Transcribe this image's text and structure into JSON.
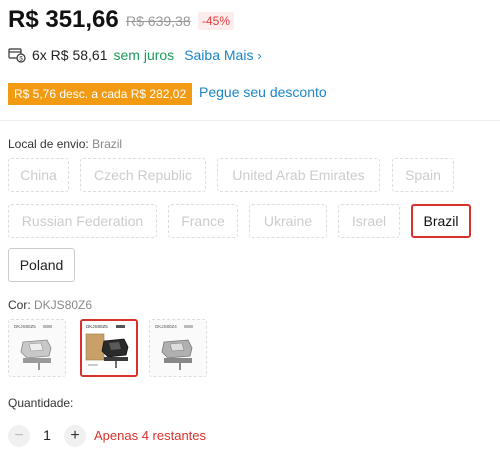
{
  "price": {
    "current": "R$ 351,66",
    "original": "R$ 639,38",
    "discount": "-45%"
  },
  "installments": {
    "icon": "installment-card-icon",
    "text": "6x R$ 58,61",
    "interest": "sem juros",
    "more_link": "Saiba Mais"
  },
  "promo": {
    "tag": "R$ 5,76 desc. a cada R$ 282,02",
    "link": "Pegue seu desconto",
    "tag_color": "#f39a13"
  },
  "shipping": {
    "label": "Local de envio:",
    "selected_value": "Brazil",
    "options": [
      {
        "label": "China",
        "state": "disabled"
      },
      {
        "label": "Czech Republic",
        "state": "disabled"
      },
      {
        "label": "United Arab Emirates",
        "state": "disabled"
      },
      {
        "label": "Spain",
        "state": "disabled"
      },
      {
        "label": "Russian Federation",
        "state": "disabled"
      },
      {
        "label": "France",
        "state": "disabled"
      },
      {
        "label": "Ukraine",
        "state": "disabled"
      },
      {
        "label": "Israel",
        "state": "disabled"
      },
      {
        "label": "Brazil",
        "state": "selected"
      },
      {
        "label": "Poland",
        "state": "available"
      }
    ]
  },
  "color": {
    "label": "Cor:",
    "selected_value": "DKJS80Z6",
    "thumbnails": [
      {
        "caption": "DKJS80Z5",
        "state": "disabled"
      },
      {
        "caption": "DKJS80Z6",
        "state": "selected"
      },
      {
        "caption": "DKJS80Z4",
        "state": "disabled"
      }
    ]
  },
  "quantity": {
    "label": "Quantidade:",
    "value": "1",
    "minus": "−",
    "plus": "+",
    "stock": "Apenas 4 restantes"
  },
  "colors": {
    "selected_border": "#d9302c",
    "link": "#1a86c8",
    "interest_green": "#1a9b5a"
  }
}
